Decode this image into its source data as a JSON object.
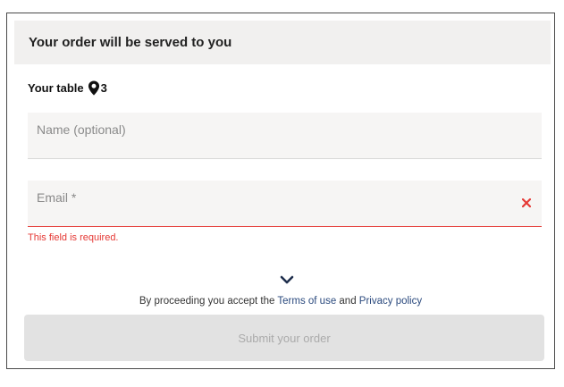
{
  "header": {
    "title": "Your order will be served to you"
  },
  "table": {
    "label": "Your table",
    "number": "3"
  },
  "form": {
    "name_placeholder": "Name (optional)",
    "email_placeholder": "Email *",
    "email_error": "This field is required."
  },
  "footer": {
    "terms_prefix": "By proceeding you accept the ",
    "terms_link": "Terms of use",
    "terms_and": " and ",
    "privacy_link": "Privacy policy",
    "submit_label": "Submit your order"
  },
  "icons": {
    "pin": "map-pin-icon",
    "clear": "clear-x-icon",
    "expand": "chevron-down-icon"
  },
  "colors": {
    "header_bg": "#f1f0ef",
    "field_bg": "#f6f5f4",
    "error": "#e53935",
    "link": "#2b4a7e",
    "button_disabled_bg": "#e2e2e2",
    "button_disabled_text": "#ababab"
  }
}
